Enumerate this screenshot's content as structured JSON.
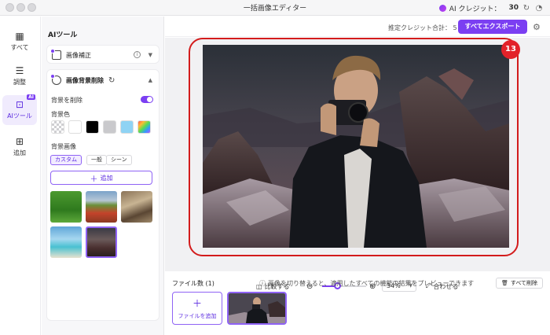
{
  "window": {
    "title": "一括画像エディター"
  },
  "credits": {
    "label": "AI クレジット：",
    "value": "30"
  },
  "nav": {
    "items": [
      {
        "label": "すべて",
        "icon": "grid-icon"
      },
      {
        "label": "調整",
        "icon": "sliders-icon"
      },
      {
        "label": "AIツール",
        "icon": "ai-tools-icon",
        "badge": "AI",
        "active": true
      },
      {
        "label": "追加",
        "icon": "add-square-icon"
      }
    ]
  },
  "panel": {
    "title": "AIツール",
    "enhance": {
      "label": "画像補正"
    },
    "bgremove": {
      "label": "画像背景削除"
    },
    "remove_bg_label": "背景を削除",
    "bg_color_label": "背景色",
    "bg_image_label": "背景画像",
    "tabs": [
      "カスタム",
      "一般",
      "シーン"
    ],
    "add_label": "追加",
    "swatch_colors": [
      "transparent",
      "#ffffff",
      "#000000",
      "#c9c9cc",
      "#8fd3f4",
      "gradient"
    ]
  },
  "main": {
    "estimate_label": "推定クレジット合計：",
    "estimate_value": "5",
    "export_label": "すべてエクスポート",
    "marker": "13",
    "compare_label": "比較する",
    "zoom_value": "34%",
    "zoom_fraction": 0.34,
    "fit_label": "合わせる",
    "file_count_label": "ファイル数",
    "file_count": "(1)",
    "hint": "画像を切り替えると、適用したすべての機能の結果をプレビューできます",
    "delete_all_label": "すべて削除",
    "add_file_label": "ファイルを追加"
  }
}
